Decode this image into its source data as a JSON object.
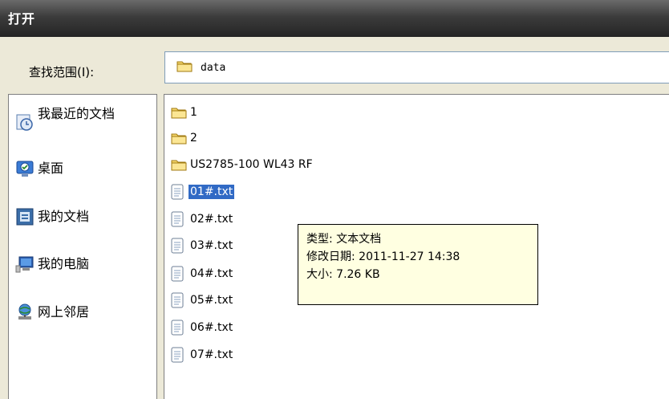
{
  "window": {
    "title": "打开"
  },
  "lookin": {
    "label": "查找范围(I):",
    "value": "data",
    "icon": "folder-icon"
  },
  "places": [
    {
      "name": "recent",
      "label": "我最近的文档",
      "icon": "recent-documents-icon"
    },
    {
      "name": "desktop",
      "label": "桌面",
      "icon": "desktop-icon"
    },
    {
      "name": "my-documents",
      "label": "我的文档",
      "icon": "my-documents-icon"
    },
    {
      "name": "my-computer",
      "label": "我的电脑",
      "icon": "my-computer-icon"
    },
    {
      "name": "network",
      "label": "网上邻居",
      "icon": "network-places-icon"
    }
  ],
  "files": [
    {
      "name": "1",
      "type": "folder"
    },
    {
      "name": "2",
      "type": "folder"
    },
    {
      "name": "US2785-100 WL43 RF",
      "type": "folder"
    },
    {
      "name": "01#.txt",
      "type": "text",
      "selected": true
    },
    {
      "name": "02#.txt",
      "type": "text"
    },
    {
      "name": "03#.txt",
      "type": "text"
    },
    {
      "name": "04#.txt",
      "type": "text"
    },
    {
      "name": "05#.txt",
      "type": "text"
    },
    {
      "name": "06#.txt",
      "type": "text"
    },
    {
      "name": "07#.txt",
      "type": "text"
    }
  ],
  "tooltip": {
    "type_line": "类型: 文本文档",
    "date_line": "修改日期: 2011-11-27 14:38",
    "size_line": "大小: 7.26 KB"
  },
  "colors": {
    "selection": "#316ac5",
    "tooltip_bg": "#ffffe1",
    "folder": "#f5d66b"
  }
}
